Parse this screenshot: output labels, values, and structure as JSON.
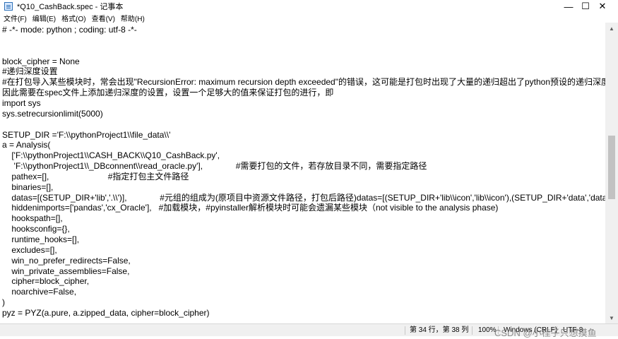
{
  "window": {
    "title": "*Q10_CashBack.spec - 记事本",
    "minimize_glyph": "—",
    "maximize_glyph": "☐",
    "close_glyph": "✕"
  },
  "menu": [
    "文件(F)",
    "编辑(E)",
    "格式(O)",
    "查看(V)",
    "帮助(H)"
  ],
  "editor": {
    "lines": [
      "# -*- mode: python ; coding: utf-8 -*-",
      "",
      "",
      "block_cipher = None",
      "#递归深度设置",
      "#在打包导入某些模块时，常会出现\"RecursionError: maximum recursion depth exceeded\"的错误，这可能是打包时出现了大量的递归超出了python预设的递归深度。",
      "因此需要在spec文件上添加递归深度的设置，设置一个足够大的值来保证打包的进行，即",
      "import sys",
      "sys.setrecursionlimit(5000)",
      "",
      "SETUP_DIR ='F:\\\\pythonProject1\\\\file_data\\\\'",
      "a = Analysis(",
      "    ['F:\\\\pythonProject1\\\\CASH_BACK\\\\Q10_CashBack.py',",
      "     'F:\\\\pythonProject1\\\\_DBconnent\\\\read_oracle.py'],              #需要打包的文件，若存放目录不同，需要指定路径",
      "    pathex=[],                         #指定打包主文件路径",
      "    binaries=[],",
      "    datas=[(SETUP_DIR+'lib','.\\\\')],              #元组的组成为(原项目中资源文件路径，打包后路径)datas=[(SETUP_DIR+'lib\\\\icon','lib\\\\icon'),(SETUP_DIR+'data','data')]",
      "    hiddenimports=['pandas','cx_Oracle'],   #加载模块，#pyinstaller解析模块时可能会遗漏某些模块（not visible to the analysis phase)",
      "    hookspath=[],",
      "    hooksconfig={},",
      "    runtime_hooks=[],",
      "    excludes=[],",
      "    win_no_prefer_redirects=False,",
      "    win_private_assemblies=False,",
      "    cipher=block_cipher,",
      "    noarchive=False,",
      ")",
      "pyz = PYZ(a.pure, a.zipped_data, cipher=block_cipher)"
    ]
  },
  "status": {
    "position": "第 34 行，第 38 列",
    "zoom": "100%",
    "line_ending": "Windows (CRLF)",
    "encoding": "UTF-8"
  },
  "watermark": "CSDN @小桂子只想摸鱼"
}
